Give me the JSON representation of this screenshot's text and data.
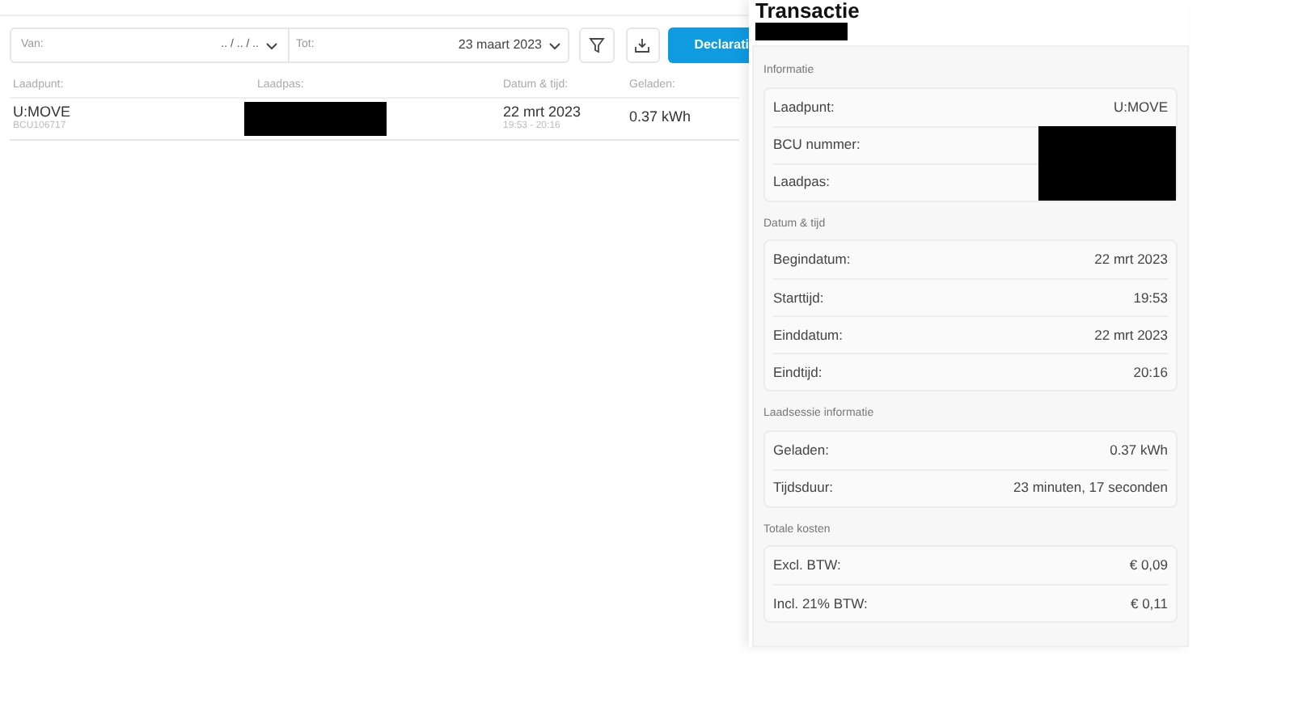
{
  "filters": {
    "from": {
      "label": "Van:",
      "value": ".. / .. / .."
    },
    "to": {
      "label": "Tot:",
      "value": "23 maart 2023"
    },
    "declare_button": "Declarati"
  },
  "table": {
    "columns": [
      "Laadpunt:",
      "Laadpas:",
      "Datum & tijd:",
      "Geladen:"
    ],
    "rows": [
      {
        "point": "U:MOVE",
        "point_id": "BCU106717",
        "date": "22 mrt 2023",
        "time": "19:53 - 20:16",
        "charged": "0.37 kWh"
      }
    ]
  },
  "panel": {
    "title": "Transactie",
    "sections": [
      {
        "title": "Informatie",
        "rows": [
          {
            "label": "Laadpunt:",
            "value": "U:MOVE"
          },
          {
            "label": "BCU nummer:",
            "redacted": true
          },
          {
            "label": "Laadpas:",
            "redacted": true
          }
        ]
      },
      {
        "title": "Datum & tijd",
        "rows": [
          {
            "label": "Begindatum:",
            "value": "22 mrt 2023"
          },
          {
            "label": "Starttijd:",
            "value": "19:53"
          },
          {
            "label": "Einddatum:",
            "value": "22 mrt 2023"
          },
          {
            "label": "Eindtijd:",
            "value": "20:16"
          }
        ]
      },
      {
        "title": "Laadsessie informatie",
        "rows": [
          {
            "label": "Geladen:",
            "value": "0.37 kWh"
          },
          {
            "label": "Tijdsduur:",
            "value": "23 minuten, 17 seconden"
          }
        ]
      },
      {
        "title": "Totale kosten",
        "rows": [
          {
            "label": "Excl. BTW:",
            "value": "€ 0,09"
          },
          {
            "label": "Incl. 21% BTW:",
            "value": "€ 0,11"
          }
        ]
      }
    ]
  }
}
